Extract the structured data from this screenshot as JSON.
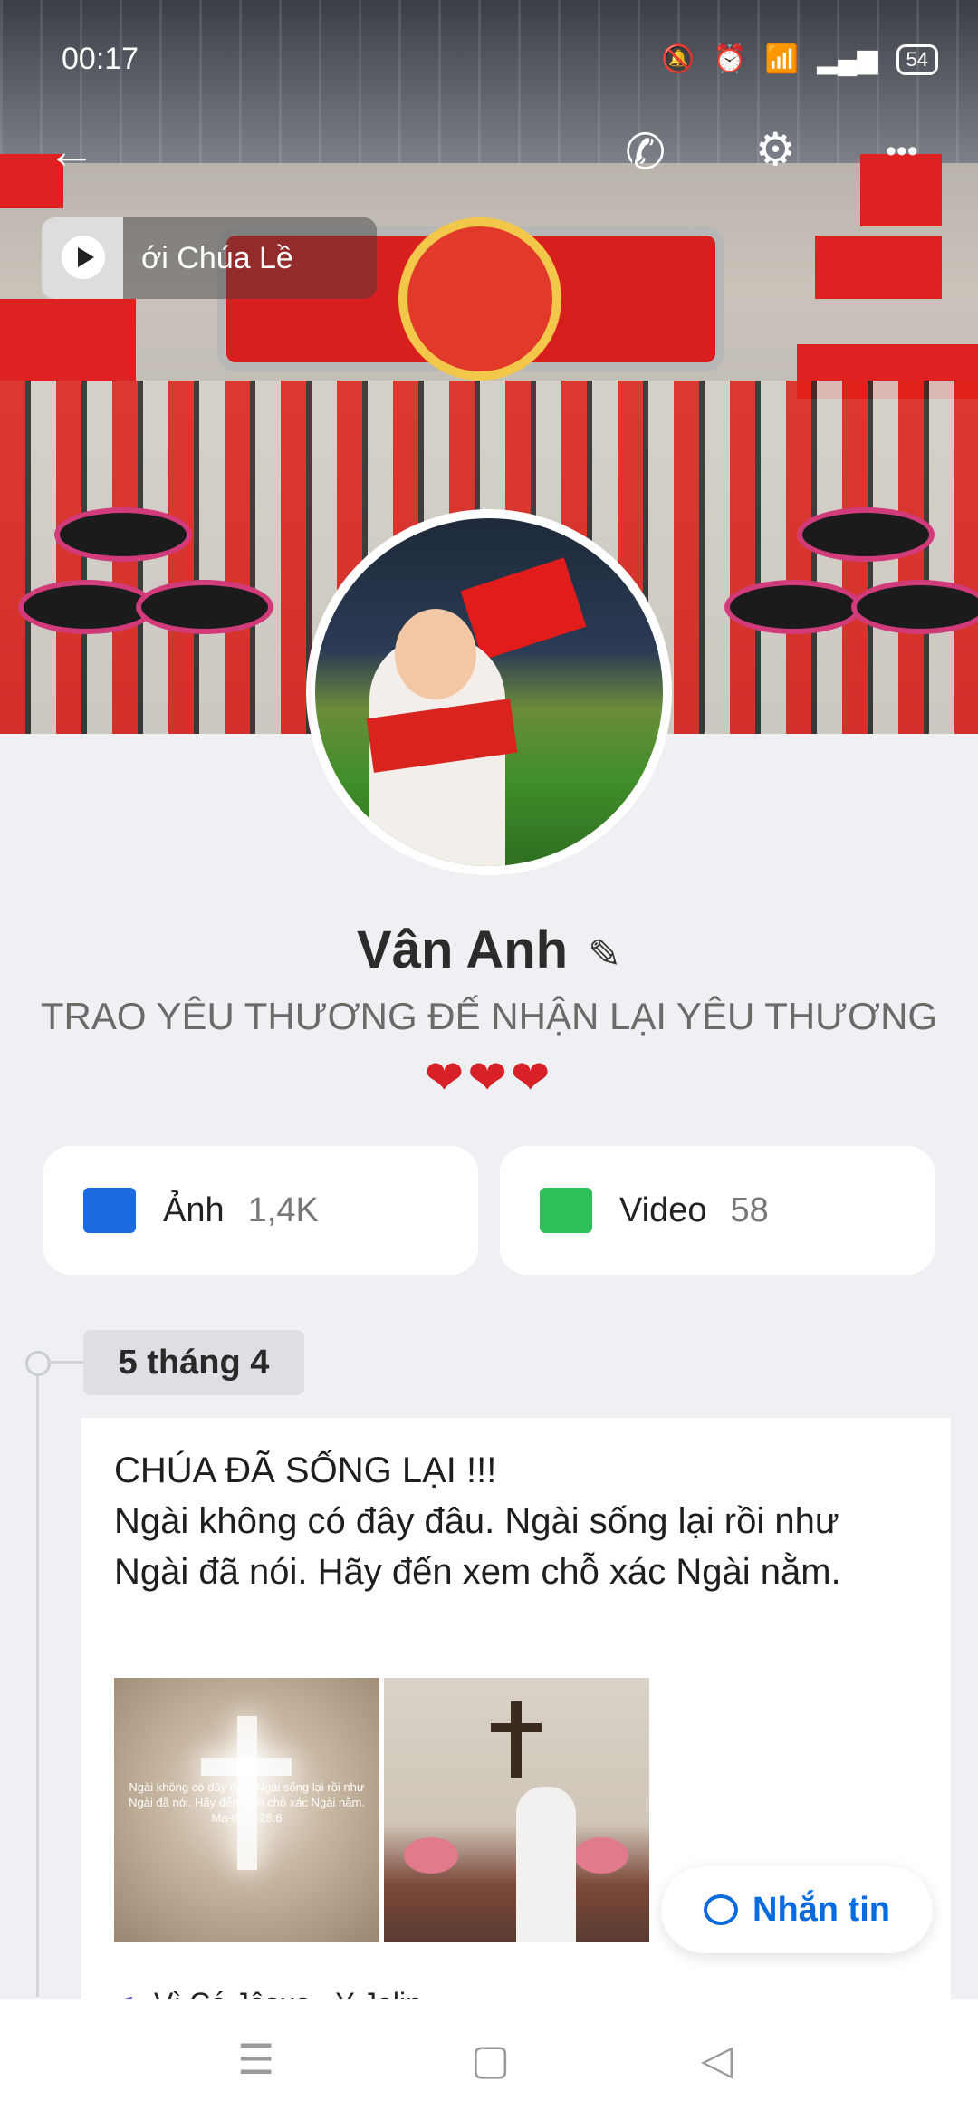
{
  "status": {
    "time": "00:17",
    "battery": "54"
  },
  "header": {
    "back": "←",
    "call": "✆",
    "profile_settings": "⚙",
    "more": "•••"
  },
  "music": {
    "chip_text": "ới Chúa        Lề"
  },
  "profile": {
    "name": "Vân Anh",
    "edit_icon": "✎",
    "bio": "TRAO YÊU THƯƠNG ĐẾ NHẬN LẠI YÊU THƯƠNG",
    "hearts": "❤❤❤"
  },
  "stats": {
    "photos": {
      "label": "Ảnh",
      "count": "1,4K",
      "icon_color": "#1a6be0"
    },
    "videos": {
      "label": "Video",
      "count": "58",
      "icon_color": "#2fbf5a"
    }
  },
  "timeline": {
    "date": "5 tháng 4",
    "post": {
      "title": "CHÚA ĐÃ SỐNG LẠI !!!",
      "body": "Ngài không có đây đâu. Ngài sống lại rồi như Ngài đã nói. Hãy đến xem chỗ xác Ngài nằm.",
      "photo1_caption": "Ngài không có đây đâu. Ngài sống lại rồi như Ngài đã nói. Hãy đến xem chỗ xác Ngài nằm. Ma-thi-ơ 28:6",
      "music": "Vì Có Jêsus - Y Jolin"
    }
  },
  "message_button": {
    "label": "Nhắn tin"
  },
  "navbar": {
    "menu": "☰",
    "home": "▢",
    "back": "◁"
  }
}
